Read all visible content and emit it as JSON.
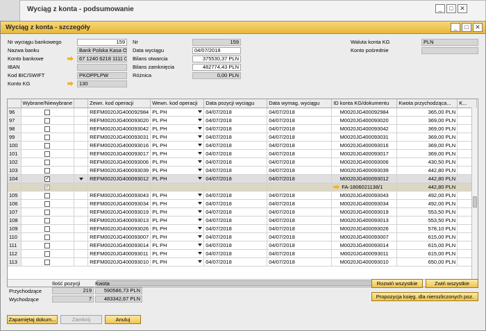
{
  "bg_window": {
    "title": "Wyciąg z konta - podsumowanie"
  },
  "window": {
    "title": "Wyciąg z konta - szczegóły",
    "controls": [
      "_",
      "□",
      "✕"
    ]
  },
  "header": {
    "nr_wyciagu_label": "Nr wyciągu bankowego",
    "nr_wyciagu_value": "159",
    "nazwa_banku_label": "Nazwa banku",
    "nazwa_banku_value": "Bank Polska Kasa Op",
    "konto_bankowe_label": "Konto bankowe",
    "konto_bankowe_value": "67 1240 6218 1111 00",
    "iban_label": "IBAN",
    "iban_value": "",
    "bic_label": "Kod BIC/SWIFT",
    "bic_value": "PKOPPLPW",
    "konto_kg_label": "Konto KG",
    "konto_kg_value": "130",
    "nr_label": "Nr",
    "nr_value": "159",
    "data_label": "Data wyciągu",
    "data_value": "04/07/2018",
    "bilans_otw_label": "Bilans otwarcia",
    "bilans_otw_value": "375530,37 PLN",
    "bilans_zam_label": "Bilans zamknięcia",
    "bilans_zam_value": "482774,43 PLN",
    "roznica_label": "Różnica",
    "roznica_value": "0,00 PLN",
    "waluta_label": "Waluta konta KG",
    "waluta_value": "PLN",
    "konto_posr_label": "Konto pośrednie",
    "konto_posr_value": ""
  },
  "columns": [
    "",
    "Wybrane/Niewybrane",
    "",
    "Zewn. kod operacji",
    "Wewn. kod operacji",
    "Data pozycji wyciągu",
    "Data wymag. wyciągu",
    "ID konta KG/dokumentu",
    "Kwota przychodząca...",
    "K..."
  ],
  "rows": [
    {
      "n": "96",
      "chk": false,
      "zewn": "REFM0020JG400092984",
      "wewn": "PL PH",
      "dpw": "04/07/2018",
      "dww": "04/07/2018",
      "id": "M0020JG400092984",
      "kw": "365,00 PLN"
    },
    {
      "n": "97",
      "chk": false,
      "zewn": "REFM0020JG400093020",
      "wewn": "PL PH",
      "dpw": "04/07/2018",
      "dww": "04/07/2018",
      "id": "M0020JG400093020",
      "kw": "369,00 PLN"
    },
    {
      "n": "98",
      "chk": false,
      "zewn": "REFM0020JG400093042",
      "wewn": "PL PH",
      "dpw": "04/07/2018",
      "dww": "04/07/2018",
      "id": "M0020JG400093042",
      "kw": "369,00 PLN"
    },
    {
      "n": "99",
      "chk": false,
      "zewn": "REFM0020JG400093031",
      "wewn": "PL PH",
      "dpw": "04/07/2018",
      "dww": "04/07/2018",
      "id": "M0020JG400093031",
      "kw": "369,00 PLN"
    },
    {
      "n": "100",
      "chk": false,
      "zewn": "REFM0020JG400093016",
      "wewn": "PL PH",
      "dpw": "04/07/2018",
      "dww": "04/07/2018",
      "id": "M0020JG400093016",
      "kw": "369,00 PLN"
    },
    {
      "n": "101",
      "chk": false,
      "zewn": "REFM0020JG400093017",
      "wewn": "PL PH",
      "dpw": "04/07/2018",
      "dww": "04/07/2018",
      "id": "M0020JG400093017",
      "kw": "369,00 PLN"
    },
    {
      "n": "102",
      "chk": false,
      "zewn": "REFM0020JG400093006",
      "wewn": "PL PH",
      "dpw": "04/07/2018",
      "dww": "04/07/2018",
      "id": "M0020JG400093006",
      "kw": "430,50 PLN"
    },
    {
      "n": "103",
      "chk": false,
      "zewn": "REFM0020JG400093039",
      "wewn": "PL PH",
      "dpw": "04/07/2018",
      "dww": "04/07/2018",
      "id": "M0020JG400093039",
      "kw": "442,80 PLN"
    },
    {
      "n": "104",
      "chk": true,
      "sel": true,
      "zewn": "REFM0020JG400093012",
      "wewn": "PL PH",
      "dpw": "04/07/2018",
      "dww": "04/07/2018",
      "id": "M0020JG400093012",
      "kw": "442,80 PLN"
    },
    {
      "n": "",
      "chk": true,
      "sub": true,
      "zewn": "",
      "wewn": "",
      "dpw": "",
      "dww": "",
      "id": "FA-1806021138/1",
      "kw": "442,80 PLN"
    },
    {
      "n": "105",
      "chk": false,
      "zewn": "REFM0020JG400093043",
      "wewn": "PL PH",
      "dpw": "04/07/2018",
      "dww": "04/07/2018",
      "id": "M0020JG400093043",
      "kw": "492,00 PLN"
    },
    {
      "n": "106",
      "chk": false,
      "zewn": "REFM0020JG400093034",
      "wewn": "PL PH",
      "dpw": "04/07/2018",
      "dww": "04/07/2018",
      "id": "M0020JG400093034",
      "kw": "492,00 PLN"
    },
    {
      "n": "107",
      "chk": false,
      "zewn": "REFM0020JG400093019",
      "wewn": "PL PH",
      "dpw": "04/07/2018",
      "dww": "04/07/2018",
      "id": "M0020JG400093019",
      "kw": "553,50 PLN"
    },
    {
      "n": "108",
      "chk": false,
      "zewn": "REFM0020JG400093013",
      "wewn": "PL PH",
      "dpw": "04/07/2018",
      "dww": "04/07/2018",
      "id": "M0020JG400093013",
      "kw": "553,50 PLN"
    },
    {
      "n": "109",
      "chk": false,
      "zewn": "REFM0020JG400093026",
      "wewn": "PL PH",
      "dpw": "04/07/2018",
      "dww": "04/07/2018",
      "id": "M0020JG400093026",
      "kw": "578,10 PLN"
    },
    {
      "n": "110",
      "chk": false,
      "zewn": "REFM0020JG400093007",
      "wewn": "PL PH",
      "dpw": "04/07/2018",
      "dww": "04/07/2018",
      "id": "M0020JG400093007",
      "kw": "615,00 PLN"
    },
    {
      "n": "111",
      "chk": false,
      "zewn": "REFM0020JG400093014",
      "wewn": "PL PH",
      "dpw": "04/07/2018",
      "dww": "04/07/2018",
      "id": "M0020JG400093014",
      "kw": "615,00 PLN"
    },
    {
      "n": "112",
      "chk": false,
      "zewn": "REFM0020JG400093011",
      "wewn": "PL PH",
      "dpw": "04/07/2018",
      "dww": "04/07/2018",
      "id": "M0020JG400093011",
      "kw": "615,00 PLN"
    },
    {
      "n": "113",
      "chk": false,
      "zewn": "REFM0020JG400093010",
      "wewn": "PL PH",
      "dpw": "04/07/2018",
      "dww": "04/07/2018",
      "id": "M0020JG400093010",
      "kw": "650,00 PLN"
    }
  ],
  "summary": {
    "ilosc_label": "Ilość pozycji",
    "kwota_label": "Kwota",
    "przych_label": "Przychodzące",
    "przych_count": "219",
    "przych_amount": "590586,73 PLN",
    "wych_label": "Wychodzące",
    "wych_count": "7",
    "wych_amount": "483342,67 PLN"
  },
  "buttons": {
    "rozwin": "Rozwiń wszystkie",
    "zwin": "Zwiń wszystkie",
    "propozycja": "Propozycja księg. dla nierozliczonych poz.",
    "zapamietaj": "Zapamiętaj dokum...",
    "zamknij": "Zamknij",
    "anuluj": "Anuluj"
  },
  "colors": {
    "accent": "#f0c450",
    "title_gradient_top": "#f7d778",
    "arrow": "#f2b31e"
  }
}
